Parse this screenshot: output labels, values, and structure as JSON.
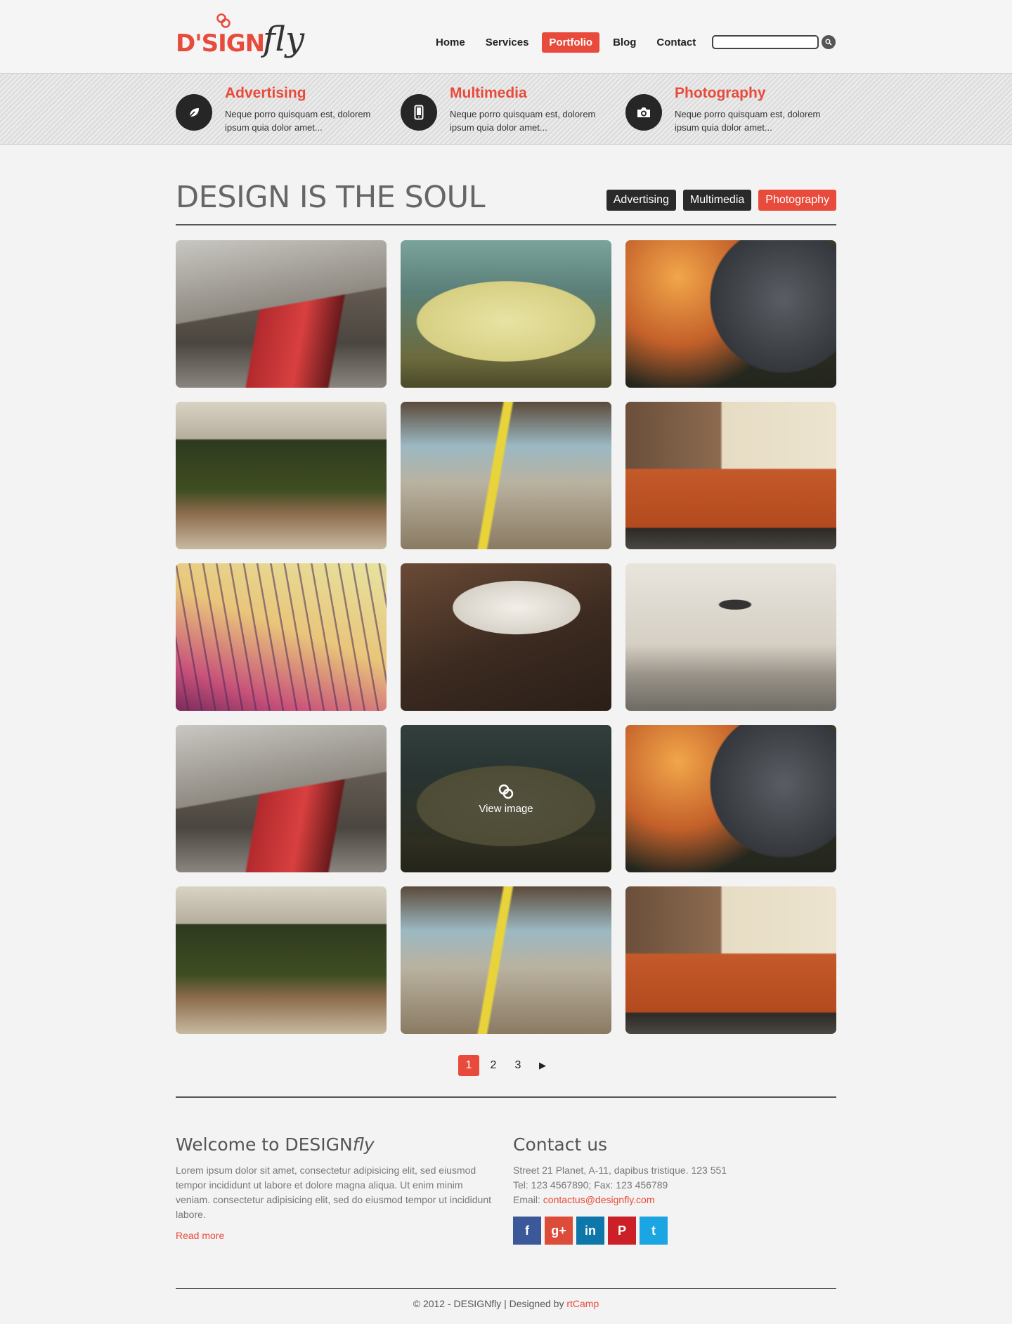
{
  "logo": {
    "main": "D'SIGN",
    "script": "fly"
  },
  "nav": {
    "items": [
      "Home",
      "Services",
      "Portfolio",
      "Blog",
      "Contact"
    ],
    "active_index": 2
  },
  "search": {
    "placeholder": ""
  },
  "services": [
    {
      "title": "Advertising",
      "text": "Neque porro quisquam est, dolorem ipsum quia dolor amet...",
      "icon": "leaf-icon"
    },
    {
      "title": "Multimedia",
      "text": "Neque porro quisquam est, dolorem ipsum quia dolor amet...",
      "icon": "mobile-phone-icon"
    },
    {
      "title": "Photography",
      "text": "Neque porro quisquam est, dolorem ipsum quia dolor amet...",
      "icon": "camera-icon"
    }
  ],
  "portfolio": {
    "title": "DESIGN IS THE SOUL",
    "filters": [
      "Advertising",
      "Multimedia",
      "Photography"
    ],
    "active_filter_index": 2,
    "hover_label": "View image",
    "tiles": [
      "london-bus-photo",
      "vintage-car-photo",
      "ostrich-selfie-photo",
      "park-crowd-photo",
      "train-platform-photo",
      "orange-van-photo",
      "bare-trees-photo",
      "office-chair-photo",
      "paragliders-photo",
      "london-bus-photo",
      "vintage-car-photo",
      "ostrich-selfie-photo",
      "park-crowd-photo",
      "train-platform-photo",
      "orange-van-photo"
    ]
  },
  "pagination": {
    "pages": [
      "1",
      "2",
      "3"
    ],
    "active_index": 0,
    "next": "▶"
  },
  "footer": {
    "welcome": {
      "title": "Welcome to DESIGN",
      "title_italic": "fly",
      "text": "Lorem ipsum dolor sit amet, consectetur adipisicing elit, sed  eiusmod tempor incididunt ut labore et dolore magna aliqua. Ut enim minim veniam. consectetur adipisicing elit, sed do eiusmod tempor ut incididunt labore.",
      "read_more": "Read more"
    },
    "contact": {
      "title": "Contact us",
      "address": "Street 21 Planet, A-11, dapibus tristique. 123 551",
      "phone": "Tel: 123 4567890; Fax: 123 456789",
      "email_label": "Email: ",
      "email": "contactus@designfly.com"
    },
    "social": [
      {
        "label": "f",
        "name": "facebook-icon",
        "color": "#3b5998"
      },
      {
        "label": "g+",
        "name": "google-plus-icon",
        "color": "#dd4b39"
      },
      {
        "label": "in",
        "name": "linkedin-icon",
        "color": "#0e76a8"
      },
      {
        "label": "P",
        "name": "pinterest-icon",
        "color": "#cb2027"
      },
      {
        "label": "t",
        "name": "twitter-icon",
        "color": "#1ba6e3"
      }
    ],
    "copyright": "© 2012 - DESIGNfly | Designed by ",
    "designer": "rtCamp"
  },
  "colors": {
    "accent": "#e84a3b",
    "dark": "#2a2a2a"
  }
}
